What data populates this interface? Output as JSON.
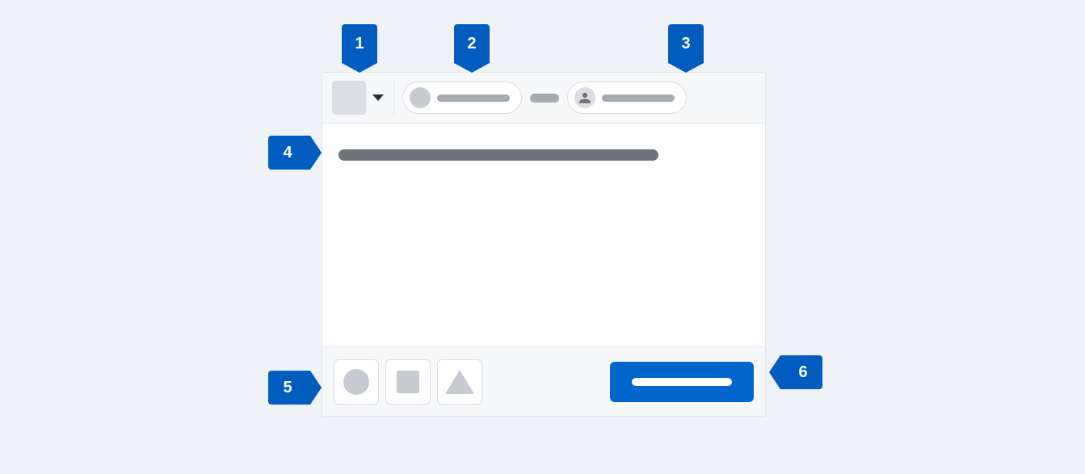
{
  "callouts": {
    "c1": "1",
    "c2": "2",
    "c3": "3",
    "c4": "4",
    "c5": "5",
    "c6": "6"
  },
  "icons": {
    "project_picker": "project-swatch-icon",
    "dropdown_caret": "chevron-down-icon",
    "epic_avatar": "avatar-icon",
    "assignee_avatar": "avatar-person-icon",
    "tool1": "circle-icon",
    "tool2": "square-icon",
    "tool3": "triangle-icon"
  },
  "colors": {
    "accent": "#005cbf",
    "primary_button": "#0066cc",
    "page_bg": "#eff2f7"
  }
}
